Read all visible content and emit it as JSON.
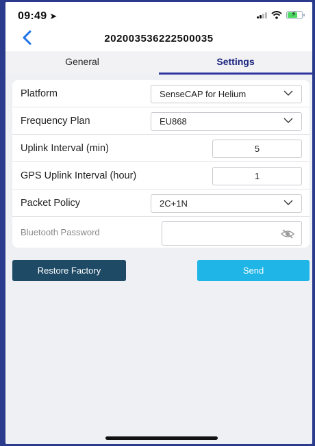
{
  "status_bar": {
    "time": "09:49"
  },
  "nav": {
    "title": "202003536222500035"
  },
  "tabs": [
    {
      "label": "General",
      "active": false
    },
    {
      "label": "Settings",
      "active": true
    }
  ],
  "form": {
    "platform": {
      "label": "Platform",
      "value": "SenseCAP for Helium"
    },
    "frequency_plan": {
      "label": "Frequency Plan",
      "value": "EU868"
    },
    "uplink_interval": {
      "label": "Uplink Interval (min)",
      "value": "5"
    },
    "gps_uplink_interval": {
      "label": "GPS Uplink Interval (hour)",
      "value": "1"
    },
    "packet_policy": {
      "label": "Packet Policy",
      "value": "2C+1N"
    },
    "bluetooth_password": {
      "label": "Bluetooth Password",
      "value": ""
    }
  },
  "actions": {
    "restore_label": "Restore Factory",
    "send_label": "Send"
  },
  "colors": {
    "accent": "#2d35a0",
    "restore": "#1e4a66",
    "send": "#1fb5e6",
    "background": "#eef0f3"
  },
  "icons": [
    "location-arrow-icon",
    "signal-icon",
    "wifi-icon",
    "battery-charging-icon",
    "back-chevron-icon",
    "chevron-down-icon",
    "eye-off-icon"
  ]
}
